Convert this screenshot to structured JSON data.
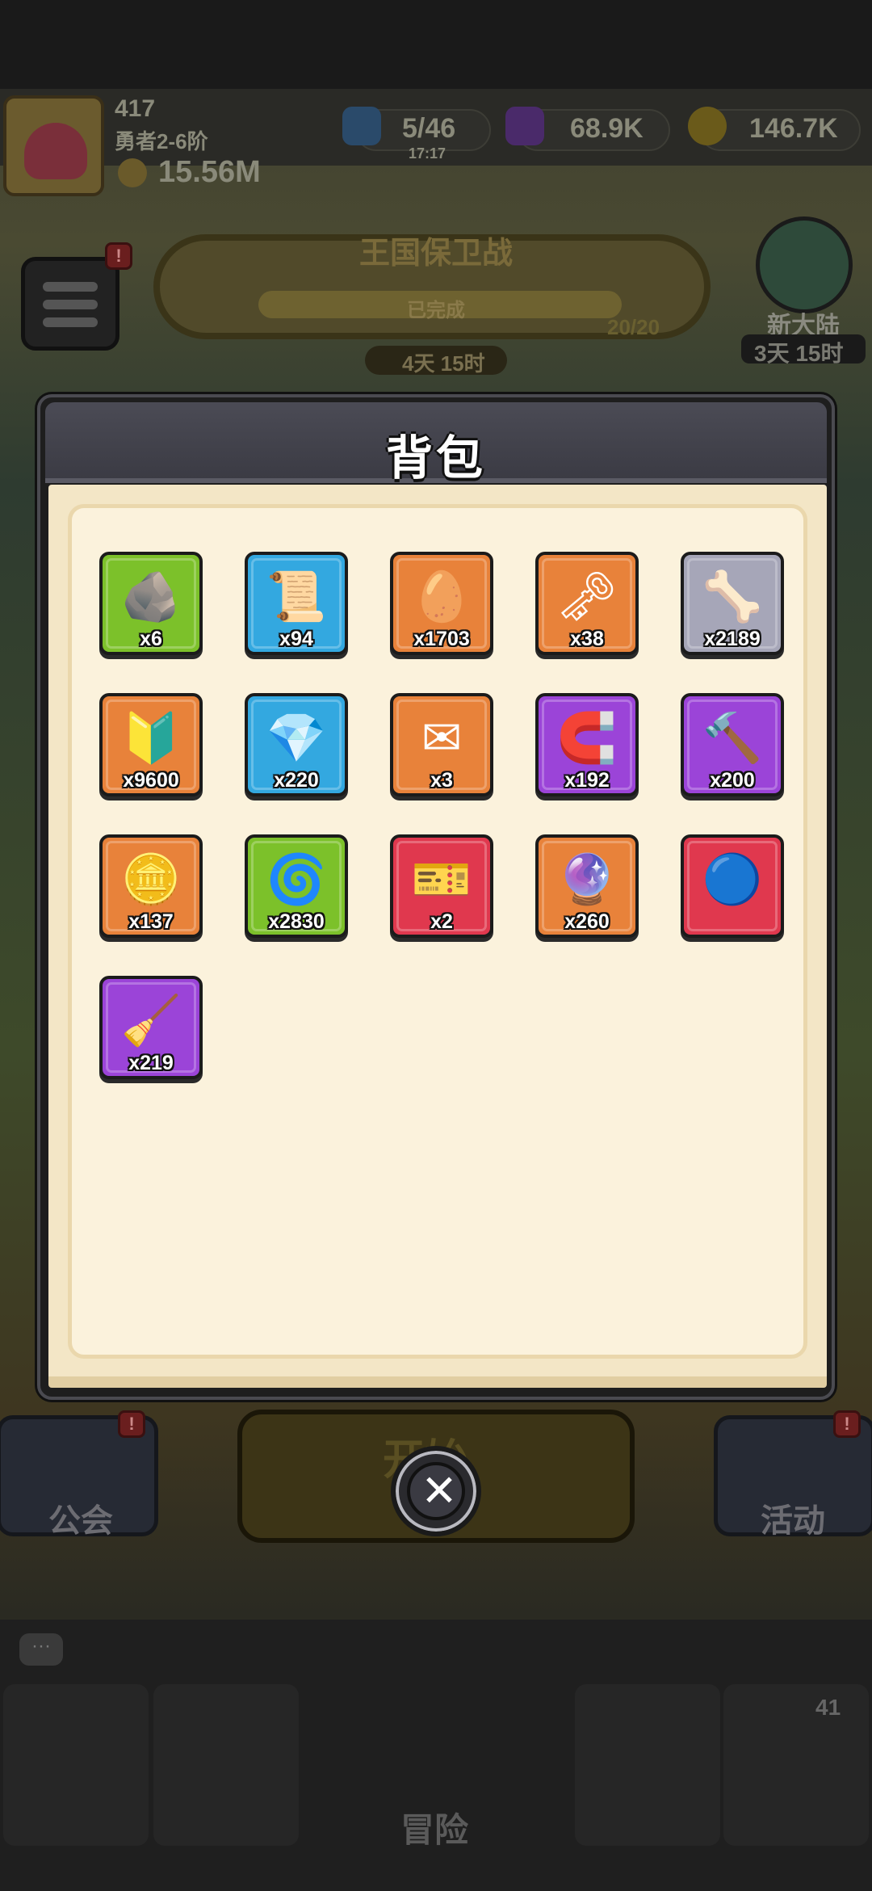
{
  "hud": {
    "player_level": "417",
    "player_rank": "勇者2-6阶",
    "power": "15.56M",
    "energy": "5/46",
    "energy_timer": "17:17",
    "gems": "68.9K",
    "gold": "146.7K",
    "menu_badge": "!"
  },
  "event": {
    "title": "王国保卫战",
    "status": "已完成",
    "progress": "20/20",
    "timer": "4天 15时"
  },
  "side_event": {
    "label": "新大陆",
    "timer": "3天 15时"
  },
  "modal": {
    "title": "背包",
    "close_glyph": "✕"
  },
  "inventory": [
    {
      "name": "rune-stone",
      "icon": "🪨",
      "qty": "x6",
      "bg": "#7cc12a"
    },
    {
      "name": "scroll",
      "icon": "📜",
      "qty": "x94",
      "bg": "#33a8e0"
    },
    {
      "name": "egg",
      "icon": "🥚",
      "qty": "x1703",
      "bg": "#e8823a"
    },
    {
      "name": "key",
      "icon": "🗝",
      "qty": "x38",
      "bg": "#e8823a"
    },
    {
      "name": "bone",
      "icon": "🦴",
      "qty": "x2189",
      "bg": "#a6a6b8"
    },
    {
      "name": "badge",
      "icon": "🔰",
      "qty": "x9600",
      "bg": "#e8823a"
    },
    {
      "name": "crystal",
      "icon": "💎",
      "qty": "x220",
      "bg": "#33a8e0"
    },
    {
      "name": "envelope",
      "icon": "✉",
      "qty": "x3",
      "bg": "#e8823a"
    },
    {
      "name": "horseshoe",
      "icon": "🧲",
      "qty": "x192",
      "bg": "#9b44d8"
    },
    {
      "name": "hammer",
      "icon": "🔨",
      "qty": "x200",
      "bg": "#9b44d8"
    },
    {
      "name": "silver-coin",
      "icon": "🪙",
      "qty": "x137",
      "bg": "#e8823a"
    },
    {
      "name": "teal-ore",
      "icon": "🌀",
      "qty": "x2830",
      "bg": "#7cc12a"
    },
    {
      "name": "ticket",
      "icon": "🎫",
      "qty": "x2",
      "bg": "#e0384e"
    },
    {
      "name": "purple-gem",
      "icon": "🔮",
      "qty": "x260",
      "bg": "#e8823a"
    },
    {
      "name": "blue-orb",
      "icon": "🔵",
      "qty": "",
      "bg": "#e0384e"
    },
    {
      "name": "broom",
      "icon": "🧹",
      "qty": "x219",
      "bg": "#9b44d8"
    }
  ],
  "bottom": {
    "start_label": "开始",
    "guild_label": "公会",
    "activity_label": "活动",
    "adventure_label": "冒险",
    "chest_count": "41",
    "chat_glyph": "···"
  }
}
